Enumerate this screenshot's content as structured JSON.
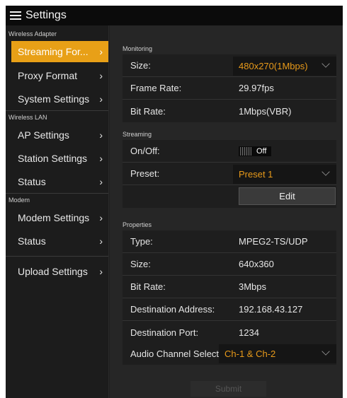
{
  "app": {
    "title": "Settings"
  },
  "sidebar": {
    "sections": [
      {
        "header": "Wireless Adapter",
        "items": [
          "Streaming For...",
          "Proxy Format",
          "System Settings"
        ]
      },
      {
        "header": "Wireless LAN",
        "items": [
          "AP Settings",
          "Station Settings",
          "Status"
        ]
      },
      {
        "header": "Modem",
        "items": [
          "Modem Settings",
          "Status"
        ]
      }
    ],
    "extra_item": "Upload Settings",
    "chevron": "›"
  },
  "monitoring": {
    "header": "Monitoring",
    "size_label": "Size:",
    "size_value": "480x270(1Mbps)",
    "frame_rate_label": "Frame Rate:",
    "frame_rate_value": "29.97fps",
    "bit_rate_label": "Bit Rate:",
    "bit_rate_value": "1Mbps(VBR)"
  },
  "streaming": {
    "header": "Streaming",
    "onoff_label": "On/Off:",
    "onoff_value": "Off",
    "preset_label": "Preset:",
    "preset_value": "Preset 1",
    "edit_label": "Edit"
  },
  "properties": {
    "header": "Properties",
    "type_label": "Type:",
    "type_value": "MPEG2-TS/UDP",
    "size_label": "Size:",
    "size_value": "640x360",
    "bit_rate_label": "Bit Rate:",
    "bit_rate_value": "3Mbps",
    "dest_addr_label": "Destination Address:",
    "dest_addr_value": "192.168.43.127",
    "dest_port_label": "Destination Port:",
    "dest_port_value": "1234"
  },
  "audio": {
    "label": "Audio Channel Select:",
    "value": "Ch-1 & Ch-2"
  },
  "submit_label": "Submit",
  "colors": {
    "accent": "#e8a017",
    "value_orange": "#e89a1a"
  }
}
